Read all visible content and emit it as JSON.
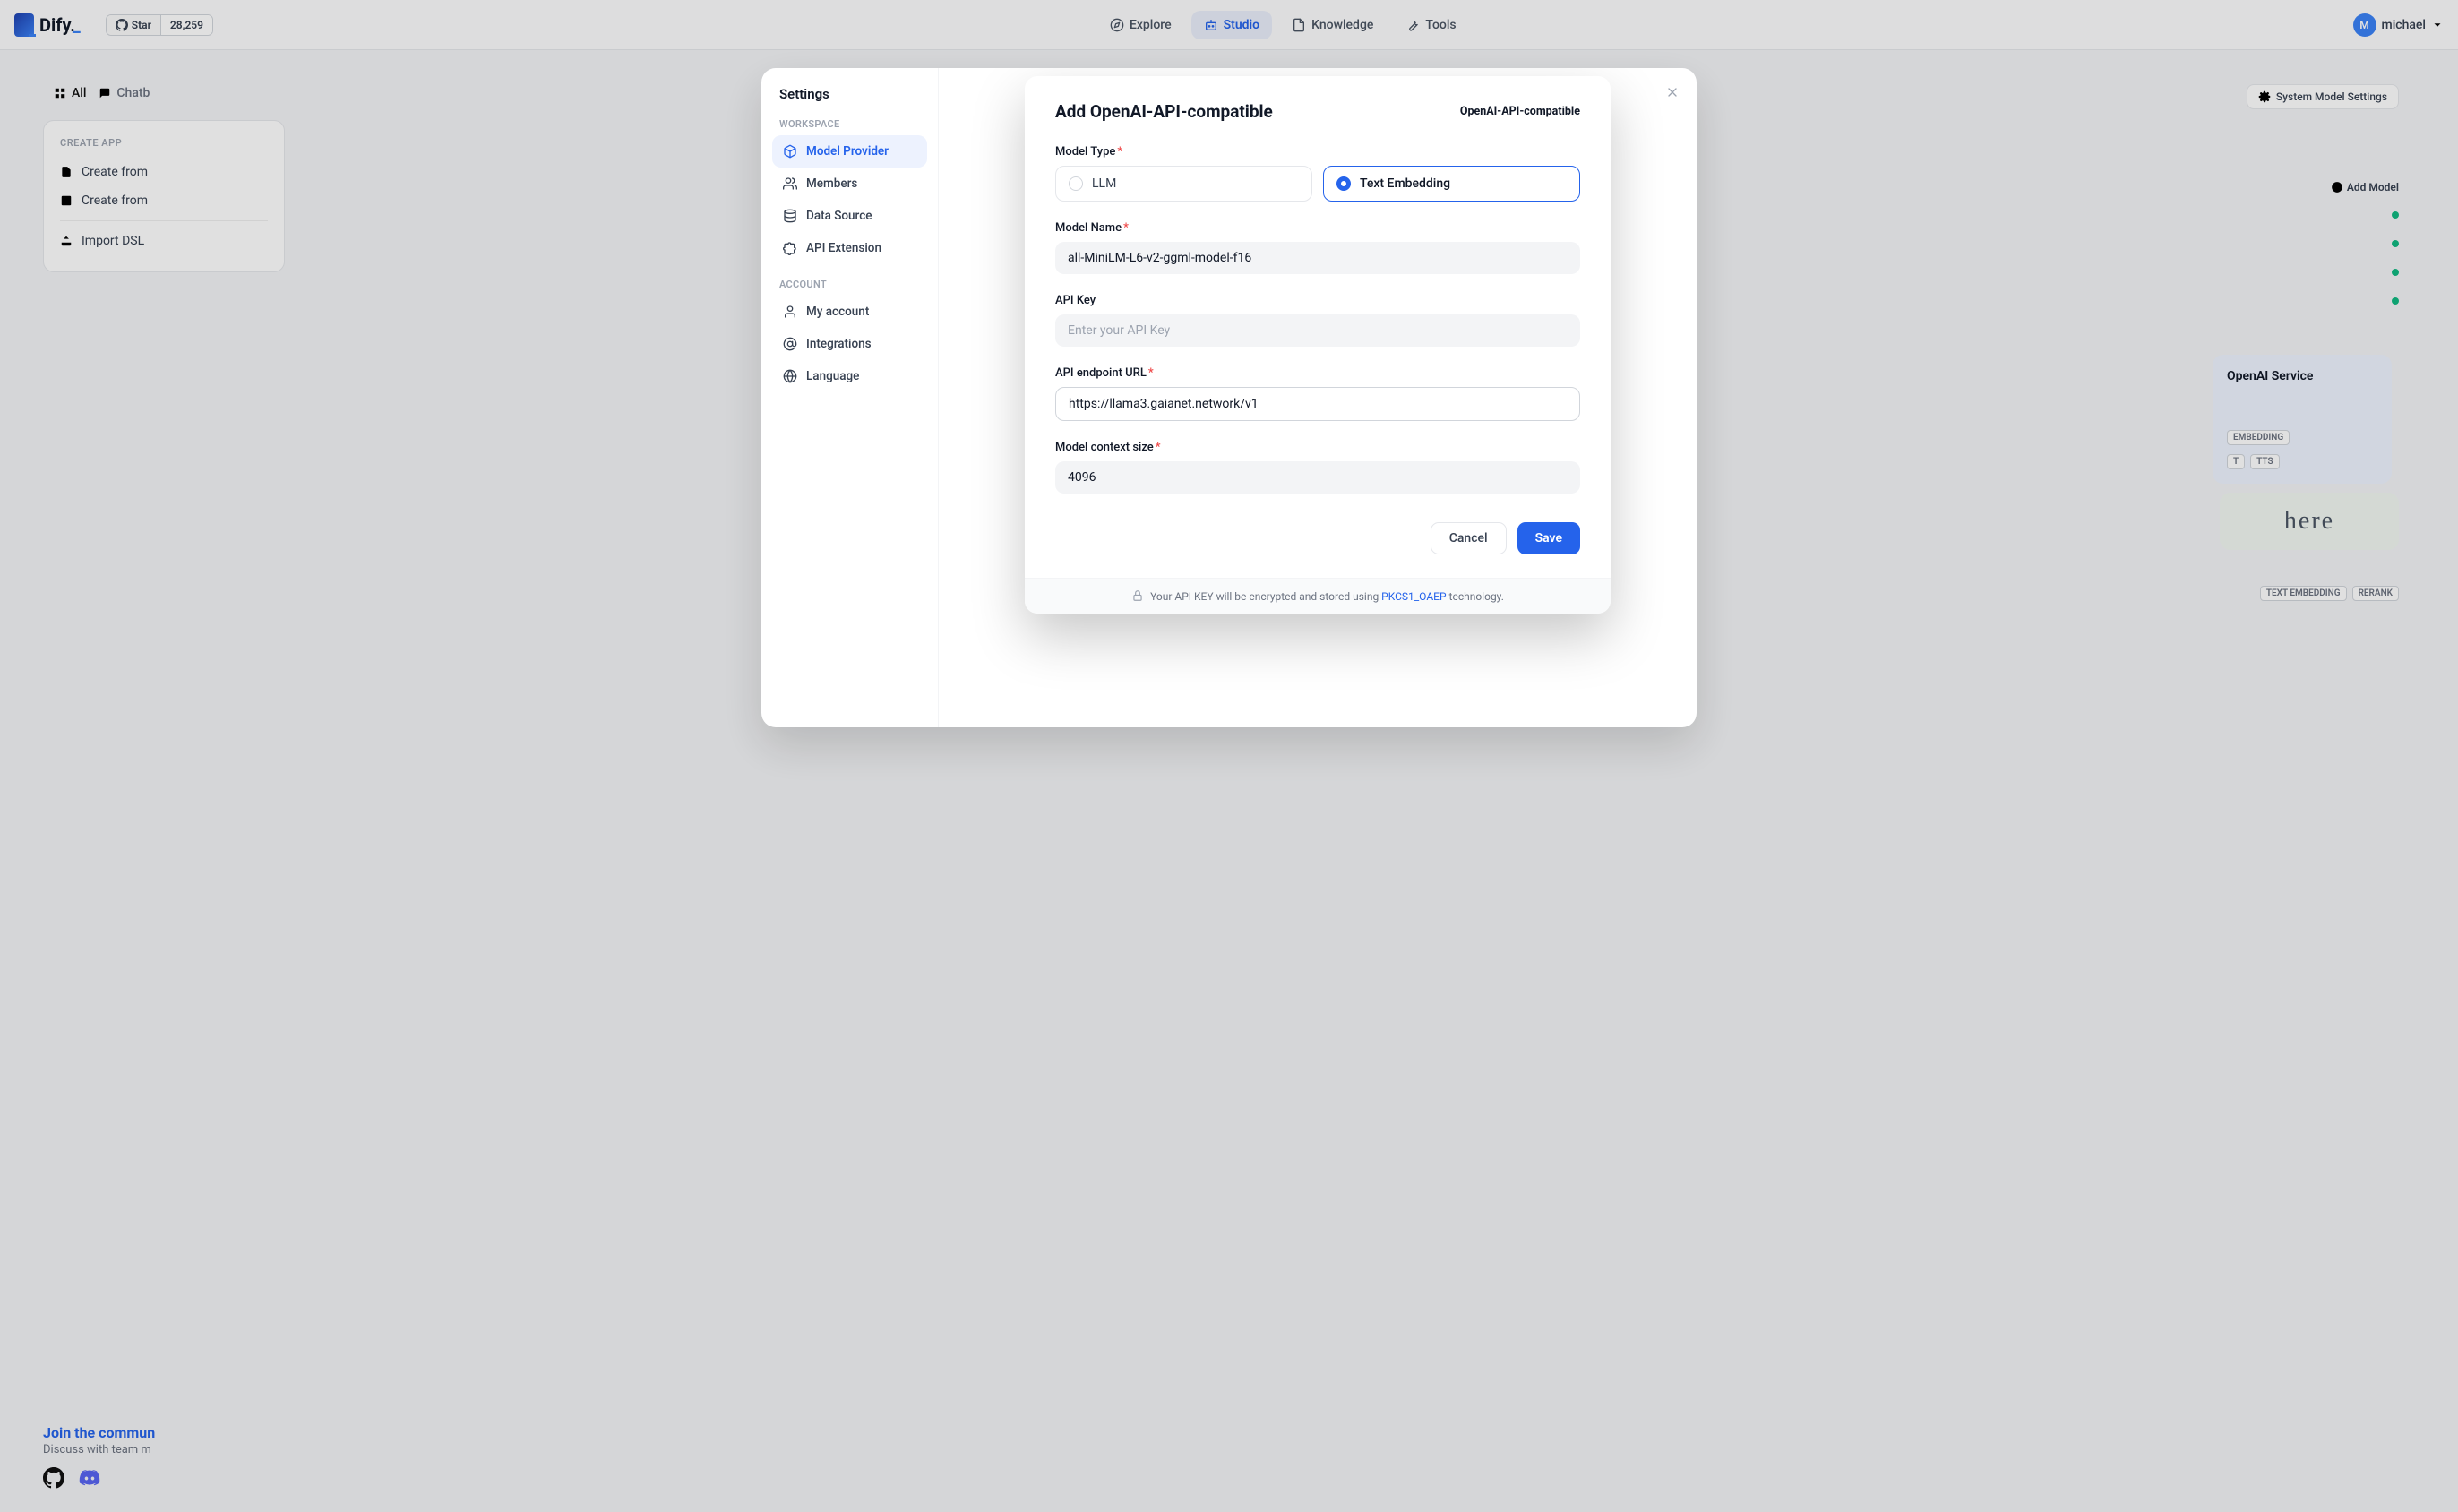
{
  "topnav": {
    "logo_text": "Dify.",
    "github": {
      "star_label": "Star",
      "star_count": "28,259"
    },
    "items": [
      {
        "label": "Explore"
      },
      {
        "label": "Studio"
      },
      {
        "label": "Knowledge"
      },
      {
        "label": "Tools"
      }
    ],
    "user": {
      "initial": "M",
      "name": "michael"
    }
  },
  "bg": {
    "create_heading": "CREATE APP",
    "create_items": [
      "Create from",
      "Create from",
      "Import DSL"
    ],
    "system_btn": "System Model Settings",
    "add_model": "Add Model",
    "openai_service": "OpenAI Service",
    "tags1": [
      "EMBEDDING",
      "T",
      "TTS"
    ],
    "cohere": "here",
    "tags2": [
      "TEXT EMBEDDING",
      "RERANK"
    ]
  },
  "join": {
    "title": "Join the commun",
    "subtitle": "Discuss with team m"
  },
  "settings": {
    "title": "Settings",
    "workspace_label": "WORKSPACE",
    "workspace_items": [
      "Model Provider",
      "Members",
      "Data Source",
      "API Extension"
    ],
    "account_label": "ACCOUNT",
    "account_items": [
      "My account",
      "Integrations",
      "Language"
    ]
  },
  "dialog": {
    "title": "Add OpenAI-API-compatible",
    "provider": "OpenAI-API-compatible",
    "fields": {
      "model_type_label": "Model Type",
      "model_type_options": [
        "LLM",
        "Text Embedding"
      ],
      "model_name_label": "Model Name",
      "model_name_value": "all-MiniLM-L6-v2-ggml-model-f16",
      "api_key_label": "API Key",
      "api_key_placeholder": "Enter your API Key",
      "api_key_value": "",
      "endpoint_label": "API endpoint URL",
      "endpoint_value": "https://llama3.gaianet.network/v1",
      "context_label": "Model context size",
      "context_value": "4096"
    },
    "cancel": "Cancel",
    "save": "Save",
    "footer_note_pre": "Your API KEY will be encrypted and stored using",
    "footer_link": "PKCS1_OAEP",
    "footer_note_post": "technology."
  }
}
